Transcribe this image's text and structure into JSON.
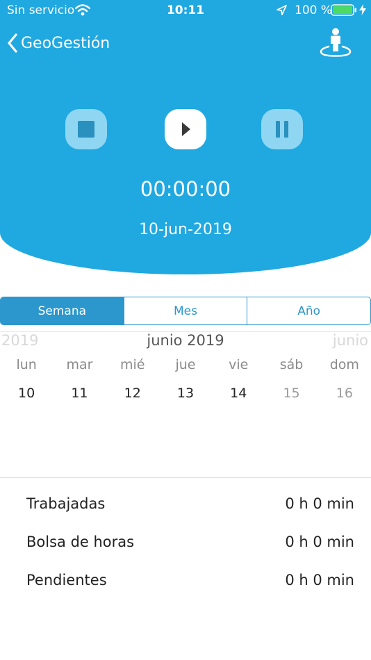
{
  "status_bar": {
    "carrier": "Sin servicio",
    "time": "10:11",
    "battery": "100 %"
  },
  "nav": {
    "back_label": "GeoGestión",
    "back_icon": "chevron-left-icon",
    "profile_icon": "user-location-icon"
  },
  "timer": {
    "elapsed": "00:00:00",
    "date": "10-jun-2019",
    "controls": [
      "stop-icon",
      "play-icon",
      "pause-icon"
    ]
  },
  "segments": [
    "Semana",
    "Mes",
    "Año"
  ],
  "calendar": {
    "prev_label": "2019",
    "month_label": "junio 2019",
    "next_label": "junio",
    "weekdays": [
      "lun",
      "mar",
      "mié",
      "jue",
      "vie",
      "sáb",
      "dom"
    ],
    "days": [
      "10",
      "11",
      "12",
      "13",
      "14",
      "15",
      "16"
    ]
  },
  "summary": [
    {
      "label": "Trabajadas",
      "value": "0 h 0 min"
    },
    {
      "label": "Bolsa de horas",
      "value": "0 h 0 min"
    },
    {
      "label": "Pendientes",
      "value": "0 h 0 min"
    }
  ],
  "colors": {
    "header": "#20a8e0",
    "secondary_button": "#8fd6f3",
    "segment_accent": "#2c97cc",
    "battery": "#4cd964"
  }
}
